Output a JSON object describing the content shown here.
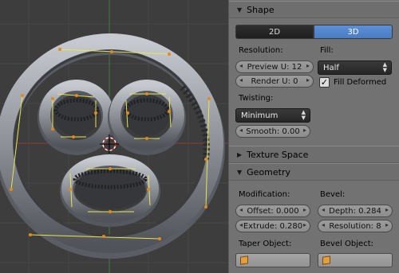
{
  "panel": {
    "shape": {
      "header": "Shape",
      "mode_2d": "2D",
      "mode_3d": "3D",
      "resolution_label": "Resolution:",
      "preview_u": "Preview U: 12",
      "render_u": "Render U: 0",
      "fill_label": "Fill:",
      "fill_value": "Half",
      "fill_deformed_label": "Fill Deformed",
      "fill_deformed_checked": true,
      "twisting_label": "Twisting:",
      "twisting_value": "Minimum",
      "smooth": "Smooth: 0.00"
    },
    "texture_space": {
      "header": "Texture Space"
    },
    "geometry": {
      "header": "Geometry",
      "modification_label": "Modification:",
      "offset": "Offset: 0.000",
      "extrude": "Extrude: 0.280",
      "bevel_label": "Bevel:",
      "depth": "Depth: 0.284",
      "resolution": "Resolution: 8",
      "taper_object_label": "Taper Object:",
      "bevel_object_label": "Bevel Object:"
    }
  },
  "colors": {
    "viewport_bg": "#3d3d3d",
    "panel_bg": "#727272",
    "accent_blue": "#5289d1",
    "vertex_orange": "#e08a20",
    "handle_yellow": "#e6e650",
    "object_gray": "#8a8d94"
  },
  "icons": [
    "triangle-down-icon",
    "triangle-right-icon",
    "checkmark-icon",
    "up-down-arrows-icon",
    "object-cube-icon",
    "3d-cursor-icon"
  ]
}
